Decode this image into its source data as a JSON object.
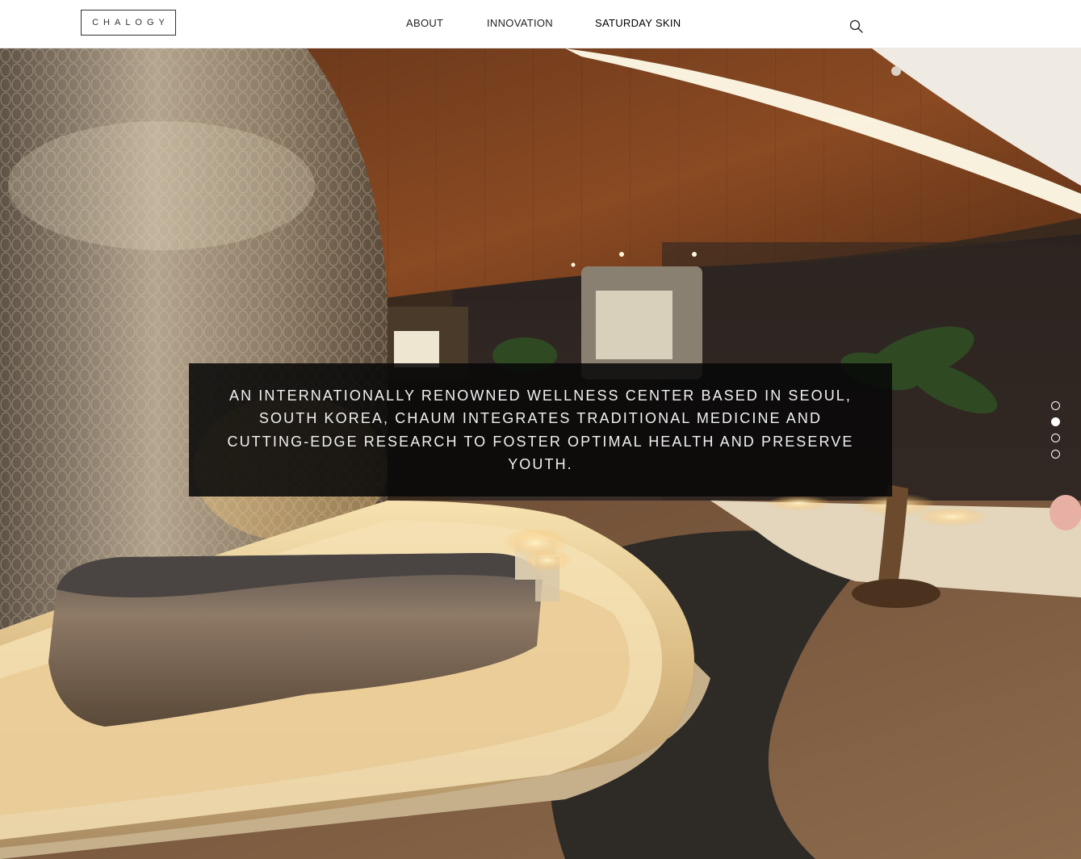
{
  "header": {
    "logo_text": "CHALOGY",
    "nav": [
      {
        "label": "ABOUT"
      },
      {
        "label": "INNOVATION"
      },
      {
        "label": "SATURDAY SKIN"
      }
    ],
    "search_icon": "search-icon"
  },
  "hero": {
    "caption": "An internationally renowned wellness center based in Seoul, South Korea, Chaum integrates traditional medicine and cutting-edge research to foster optimal health and preserve youth.",
    "slider": {
      "total": 4,
      "active_index": 1
    }
  },
  "colors": {
    "header_bg": "#ffffff",
    "caption_bg": "#080808",
    "caption_text": "#f2f2f2",
    "dot": "#ffffff"
  }
}
